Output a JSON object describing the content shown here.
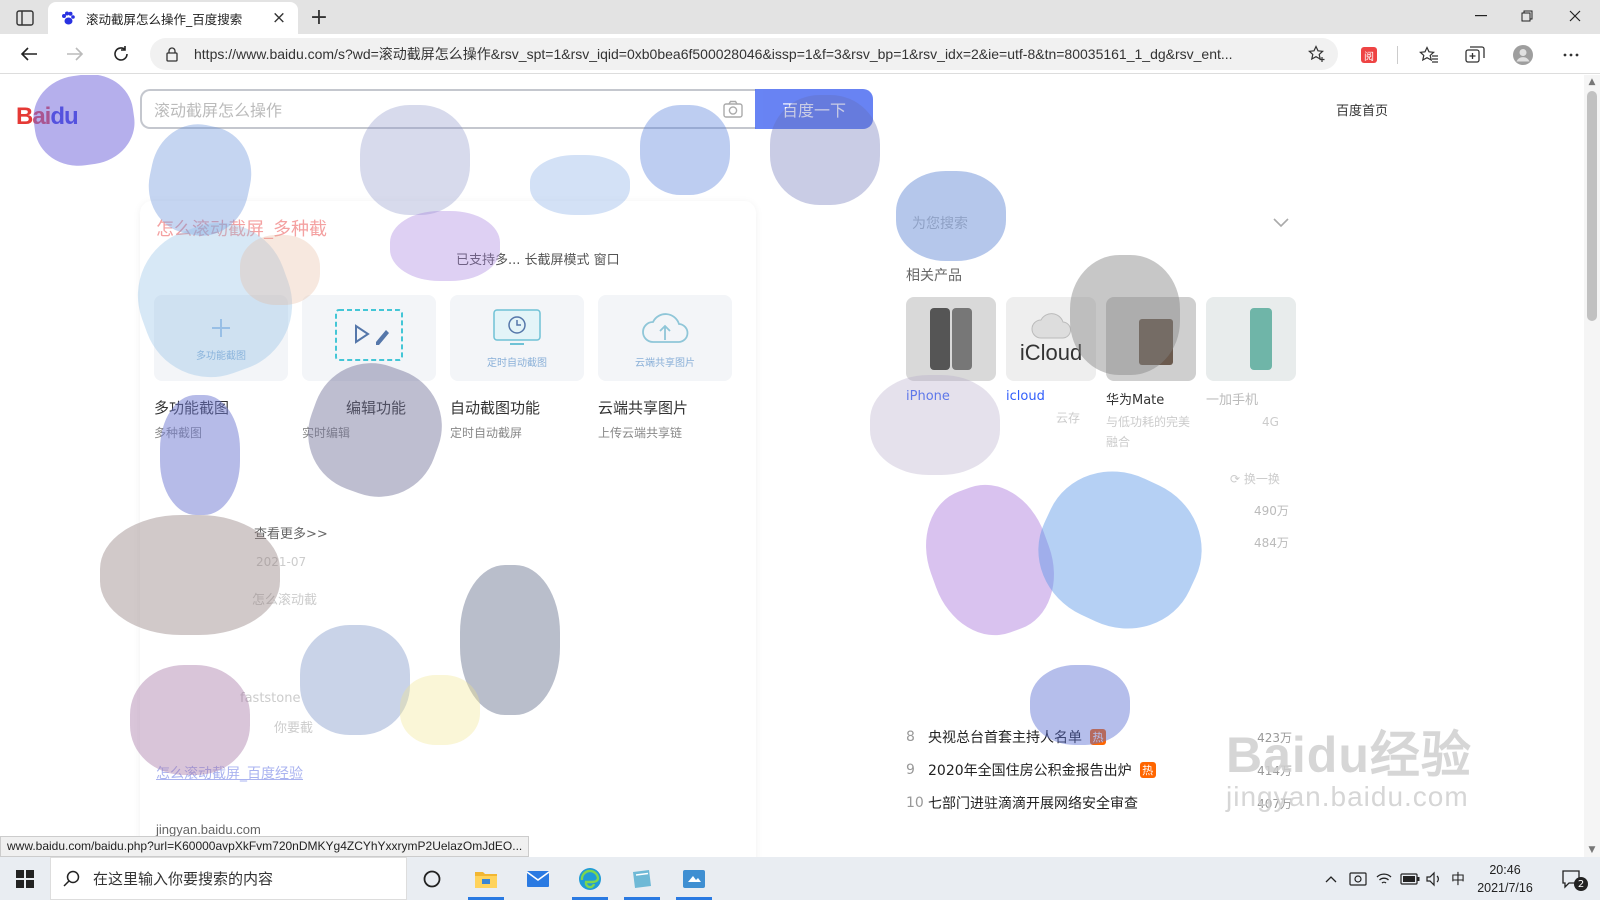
{
  "browser": {
    "tab_title": "滚动截屏怎么操作_百度搜索",
    "url": "https://www.baidu.com/s?wd=滚动截屏怎么操作&rsv_spt=1&rsv_iqid=0xb0bea6f500028046&issp=1&f=3&rsv_bp=1&rsv_idx=2&ie=utf-8&tn=80035161_1_dg&rsv_ent...",
    "status_url": "www.baidu.com/baidu.php?url=K60000avpXkFvm720nDMKYg4ZCYhYxxrymP2UelazOmJdEO..."
  },
  "search": {
    "logo_bai": "Bai",
    "logo_du": "du",
    "query": "滚动截屏怎么操作",
    "button_label": "百度一下",
    "home_link": "百度首页"
  },
  "result": {
    "title": "怎么滚动截屏_多种截",
    "desc": "已支持多... 长截屏模式 窗口",
    "features": [
      {
        "thumb_label": "多功能截图",
        "title": "多功能截图",
        "sub": "多种截图"
      },
      {
        "thumb_label": "",
        "title": "编辑功能",
        "sub": "实时编辑"
      },
      {
        "thumb_label": "定时自动截图",
        "title": "自动截图功能",
        "sub": "定时自动截屏"
      },
      {
        "thumb_label": "云端共享图片",
        "title": "云端共享图片",
        "sub": "上传云端共享链"
      }
    ],
    "more": "查看更多>>",
    "date": "2021-07",
    "line2": "怎么滚动截",
    "line3": "faststone",
    "line4": "你要截",
    "bottom_link": "怎么滚动截屏_百度经验",
    "source": "jingyan.baidu.com"
  },
  "right": {
    "header": "为您搜索",
    "related_label": "相关产品",
    "products": [
      {
        "name": "iPhone",
        "desc": ""
      },
      {
        "name": "icloud",
        "desc": "云存"
      },
      {
        "name": "华为Mate",
        "desc": "与低功耗的完美融合"
      },
      {
        "name": "一加手机",
        "desc": "4G"
      }
    ],
    "icloud_text": "iCloud",
    "refresh": "换一换",
    "faded_counts": [
      "490万",
      "484万"
    ],
    "hot_list": [
      {
        "rank": "8",
        "title": "央视总台首套主持人名单",
        "badge": "热",
        "count": "423万"
      },
      {
        "rank": "9",
        "title": "2020年全国住房公积金报告出炉",
        "badge": "热",
        "count": "414万"
      },
      {
        "rank": "10",
        "title": "七部门进驻滴滴开展网络安全审查",
        "badge": "",
        "count": "407万"
      }
    ]
  },
  "watermark": {
    "main": "Baidu经验",
    "sub": "jingyan.baidu.com"
  },
  "taskbar": {
    "search_placeholder": "在这里输入你要搜索的内容",
    "ime": "中",
    "time": "20:46",
    "date": "2021/7/16",
    "notification_count": "2"
  },
  "colors": {
    "baidu_red": "#e53935",
    "baidu_blue": "#2932e1",
    "search_button": "#4e6ef2",
    "hot_badge": "#ff6600",
    "link_blue": "#315efb"
  }
}
